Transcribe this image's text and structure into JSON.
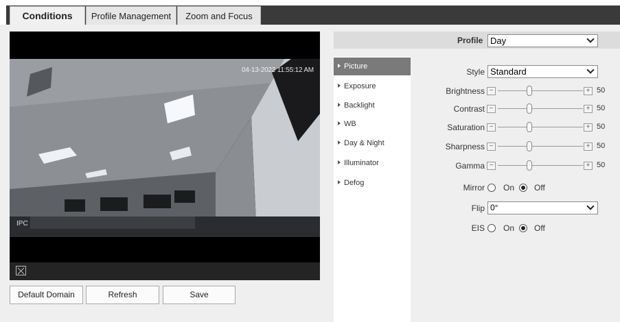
{
  "tabs": [
    {
      "label": "Conditions",
      "active": true
    },
    {
      "label": "Profile Management",
      "active": false
    },
    {
      "label": "Zoom and Focus",
      "active": false
    }
  ],
  "video": {
    "osd_time": "04-13-2022 11:55:12 AM",
    "osd_channel": "IPC",
    "fit_icon": "fit-window-icon"
  },
  "buttons": {
    "default_domain": "Default Domain",
    "refresh": "Refresh",
    "save": "Save"
  },
  "profile": {
    "label": "Profile",
    "value": "Day"
  },
  "menu": [
    {
      "label": "Picture",
      "active": true
    },
    {
      "label": "Exposure",
      "active": false
    },
    {
      "label": "Backlight",
      "active": false
    },
    {
      "label": "WB",
      "active": false
    },
    {
      "label": "Day & Night",
      "active": false
    },
    {
      "label": "Illuminator",
      "active": false
    },
    {
      "label": "Defog",
      "active": false
    }
  ],
  "picture": {
    "style": {
      "label": "Style",
      "value": "Standard"
    },
    "sliders": [
      {
        "label": "Brightness",
        "value": "50",
        "fraction": 0.5
      },
      {
        "label": "Contrast",
        "value": "50",
        "fraction": 0.5
      },
      {
        "label": "Saturation",
        "value": "50",
        "fraction": 0.5
      },
      {
        "label": "Sharpness",
        "value": "50",
        "fraction": 0.5
      },
      {
        "label": "Gamma",
        "value": "50",
        "fraction": 0.5
      }
    ],
    "mirror": {
      "label": "Mirror",
      "on_label": "On",
      "off_label": "Off",
      "selected": "off"
    },
    "flip": {
      "label": "Flip",
      "value": "0°"
    },
    "eis": {
      "label": "EIS",
      "on_label": "On",
      "off_label": "Off",
      "selected": "off"
    }
  }
}
